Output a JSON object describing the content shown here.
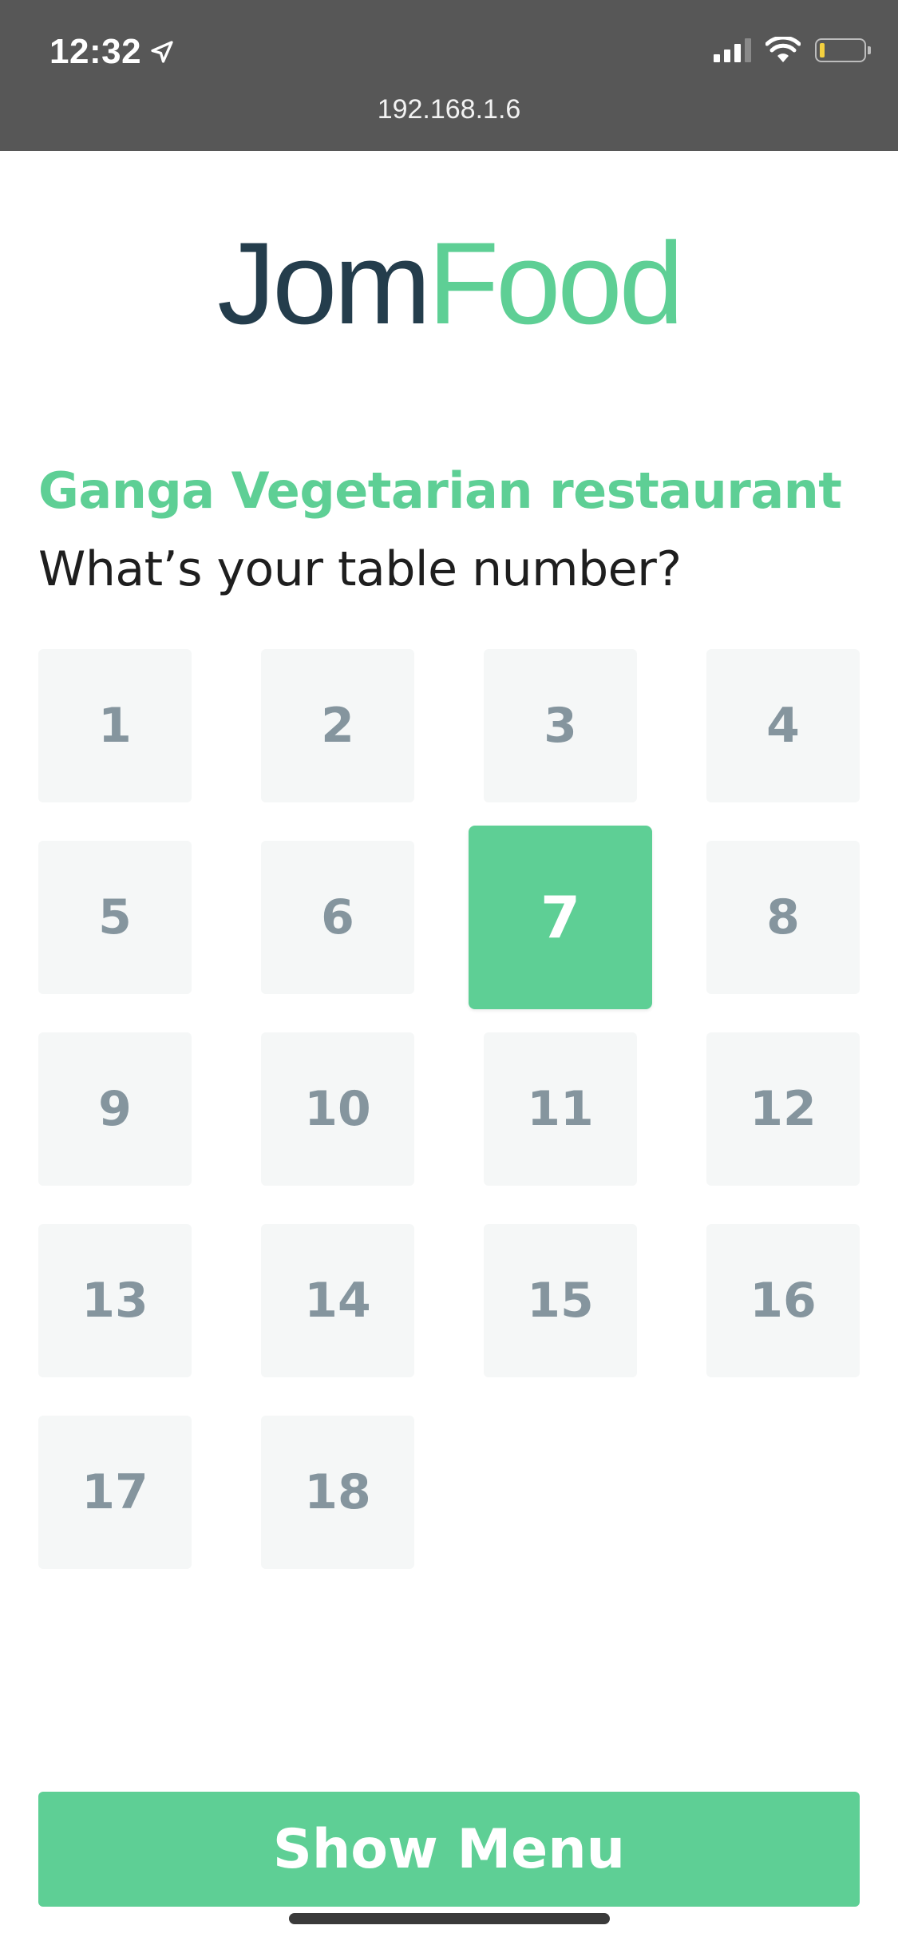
{
  "status_bar": {
    "time": "12:32",
    "url": "192.168.1.6",
    "battery_level": 0.12,
    "signal_bars_active": 3,
    "signal_bars_total": 4
  },
  "logo": {
    "part1": "Jom",
    "part2": "Food"
  },
  "restaurant_name": "Ganga Vegetarian restaurant",
  "prompt": "What’s your table number?",
  "tables": [
    "1",
    "2",
    "3",
    "4",
    "5",
    "6",
    "7",
    "8",
    "9",
    "10",
    "11",
    "12",
    "13",
    "14",
    "15",
    "16",
    "17",
    "18"
  ],
  "selected_table": "7",
  "show_menu_label": "Show Menu",
  "colors": {
    "accent": "#5ecf95",
    "brand_dark": "#243d4c",
    "tile_bg": "#f5f7f7",
    "tile_text": "#85959e",
    "chrome_bg": "#575757"
  }
}
